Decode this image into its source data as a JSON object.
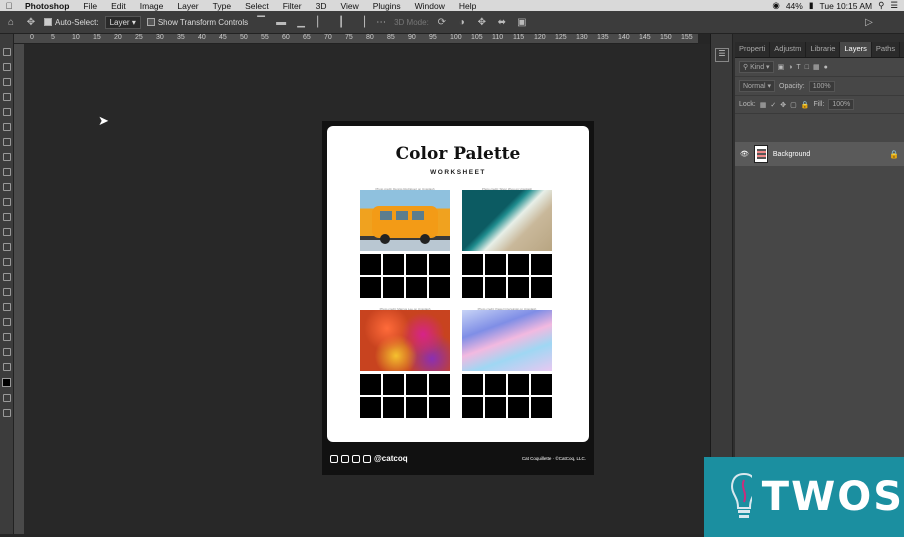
{
  "menubar": {
    "apple": "",
    "items": [
      "Photoshop",
      "File",
      "Edit",
      "Image",
      "Layer",
      "Type",
      "Select",
      "Filter",
      "3D",
      "View",
      "Plugins",
      "Window",
      "Help"
    ],
    "battery": "44%",
    "clock": "Tue 10:15 AM"
  },
  "options": {
    "auto_select_label": "Auto-Select:",
    "auto_select_value": "Layer",
    "transform_label": "Show Transform Controls",
    "mode_3d": "3D Mode:"
  },
  "ruler": {
    "labels": [
      "0",
      "5",
      "10",
      "15",
      "20",
      "25",
      "30",
      "35",
      "40",
      "45",
      "50",
      "55",
      "60",
      "65",
      "70",
      "75",
      "80",
      "85",
      "90",
      "95",
      "100",
      "105",
      "110",
      "115",
      "120",
      "125",
      "130",
      "135",
      "140",
      "145",
      "150",
      "155"
    ]
  },
  "document": {
    "title": "Color Palette",
    "subtitle": "WORKSHEET",
    "credits": [
      "Photo credit: Dennis Rodriguez on Unsplash",
      "Photo credit: Silver Zhou on Unsplash",
      "Photo credit: Marcus Lee on Unsplash",
      "Photo credit: Pawel Czerwinski on Unsplash"
    ],
    "handle": "@catcoq",
    "copyright": "Cat Coquillette · ©CatCoq, LLC."
  },
  "panel": {
    "tabs": [
      "Properti",
      "Adjustm",
      "Librarie",
      "Layers",
      "Paths"
    ],
    "active_tab": "Layers",
    "kind_label": "Kind",
    "blend_mode": "Normal",
    "opacity_label": "Opacity:",
    "opacity_value": "100%",
    "lock_label": "Lock:",
    "fill_label": "Fill:",
    "fill_value": "100%",
    "layer_name": "Background"
  },
  "watermark": {
    "text": "TWOS"
  },
  "colors": {
    "accent": "#1b8fa0",
    "menubar": "#d9d9d9",
    "panel": "#474747",
    "canvas": "#282828"
  }
}
